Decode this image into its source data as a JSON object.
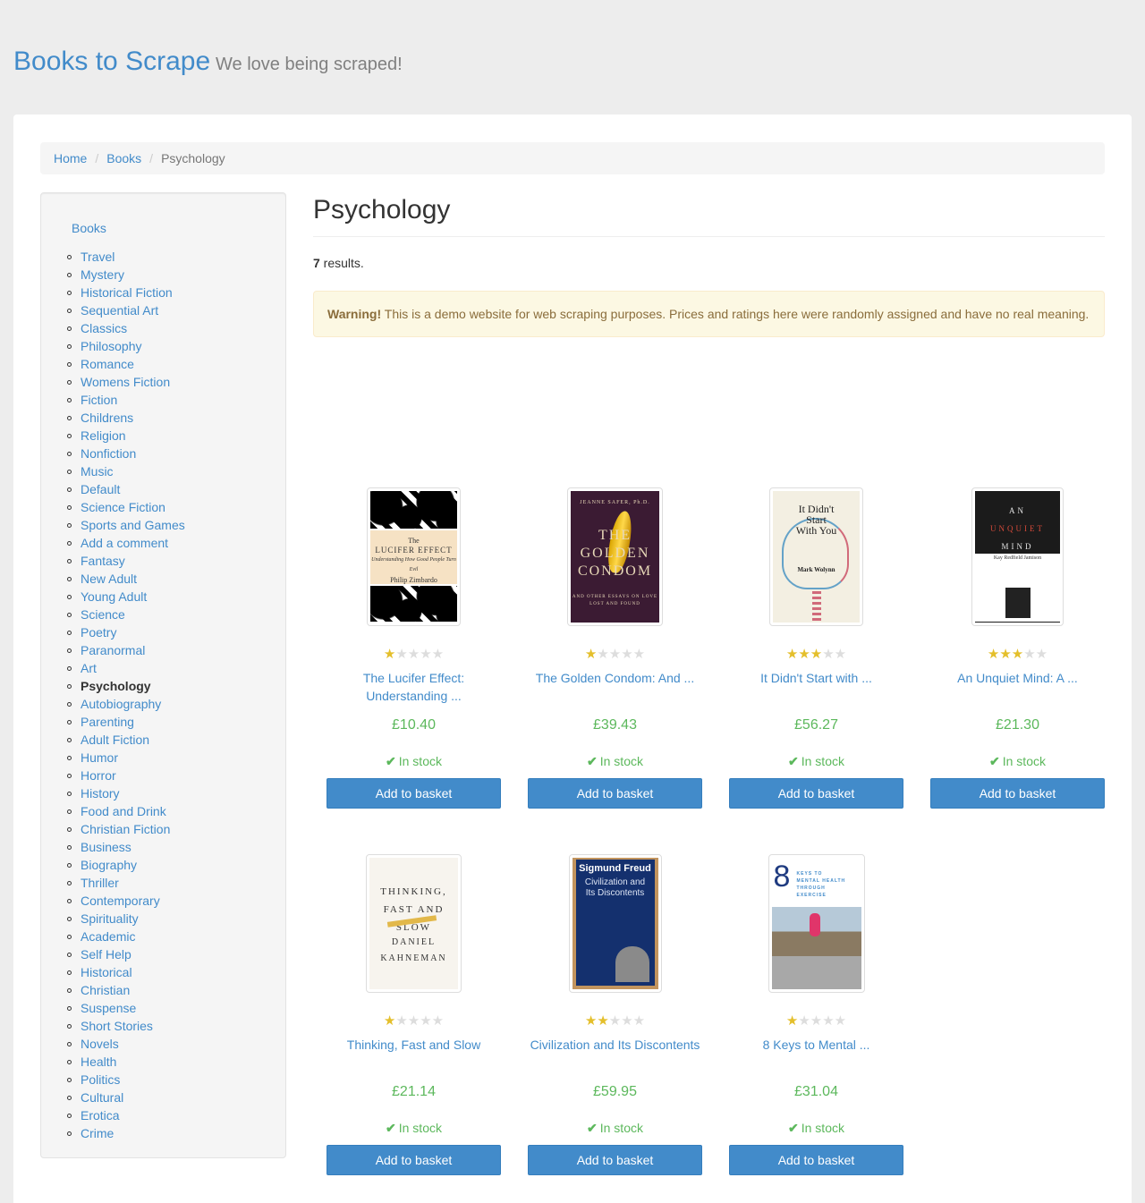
{
  "header": {
    "brand": "Books to Scrape",
    "tagline": "We love being scraped!"
  },
  "breadcrumb": {
    "home": "Home",
    "books": "Books",
    "current": "Psychology"
  },
  "sidebar": {
    "root": "Books",
    "current": "Psychology",
    "categories": [
      "Travel",
      "Mystery",
      "Historical Fiction",
      "Sequential Art",
      "Classics",
      "Philosophy",
      "Romance",
      "Womens Fiction",
      "Fiction",
      "Childrens",
      "Religion",
      "Nonfiction",
      "Music",
      "Default",
      "Science Fiction",
      "Sports and Games",
      "Add a comment",
      "Fantasy",
      "New Adult",
      "Young Adult",
      "Science",
      "Poetry",
      "Paranormal",
      "Art",
      "Psychology",
      "Autobiography",
      "Parenting",
      "Adult Fiction",
      "Humor",
      "Horror",
      "History",
      "Food and Drink",
      "Christian Fiction",
      "Business",
      "Biography",
      "Thriller",
      "Contemporary",
      "Spirituality",
      "Academic",
      "Self Help",
      "Historical",
      "Christian",
      "Suspense",
      "Short Stories",
      "Novels",
      "Health",
      "Politics",
      "Cultural",
      "Erotica",
      "Crime"
    ]
  },
  "main": {
    "title": "Psychology",
    "results_count": "7",
    "results_suffix": " results.",
    "alert_label": "Warning!",
    "alert_text": " This is a demo website for web scraping purposes. Prices and ratings here were randomly assigned and have no real meaning."
  },
  "colors": {
    "accent": "#428bca",
    "price_green": "#5cb85c",
    "star_on": "#e4bf2b",
    "star_off": "#dddddd"
  },
  "products": [
    {
      "title": "The Lucifer Effect: Understanding ...",
      "price": "£10.40",
      "rating": 1,
      "availability": "In stock",
      "button": "Add to basket",
      "cover_text": [
        "The",
        "LUCIFER EFFECT",
        "Understanding How Good People Turn Evil",
        "Philip Zimbardo"
      ]
    },
    {
      "title": "The Golden Condom: And ...",
      "price": "£39.43",
      "rating": 1,
      "availability": "In stock",
      "button": "Add to basket",
      "cover_text": [
        "JEANNE SAFER, Ph.D.",
        "THE GOLDEN CONDOM",
        "AND OTHER ESSAYS ON LOVE LOST AND FOUND"
      ]
    },
    {
      "title": "It Didn't Start with ...",
      "price": "£56.27",
      "rating": 3,
      "availability": "In stock",
      "button": "Add to basket",
      "cover_text": [
        "It Didn't Start With You",
        "Mark Wolynn"
      ]
    },
    {
      "title": "An Unquiet Mind: A ...",
      "price": "£21.30",
      "rating": 3,
      "availability": "In stock",
      "button": "Add to basket",
      "cover_text": [
        "AN",
        "UNQUIET",
        "MIND",
        "Kay Redfield Jamison"
      ]
    },
    {
      "title": "Thinking, Fast and Slow",
      "price": "£21.14",
      "rating": 1,
      "availability": "In stock",
      "button": "Add to basket",
      "cover_text": [
        "THINKING,",
        "FAST AND SLOW",
        "DANIEL",
        "KAHNEMAN"
      ]
    },
    {
      "title": "Civilization and Its Discontents",
      "price": "£59.95",
      "rating": 2,
      "availability": "In stock",
      "button": "Add to basket",
      "cover_text": [
        "Sigmund Freud",
        "Civilization and Its Discontents"
      ]
    },
    {
      "title": "8 Keys to Mental ...",
      "price": "£31.04",
      "rating": 1,
      "availability": "In stock",
      "button": "Add to basket",
      "cover_text": [
        "8",
        "KEYS TO MENTAL HEALTH THROUGH EXERCISE"
      ]
    }
  ]
}
